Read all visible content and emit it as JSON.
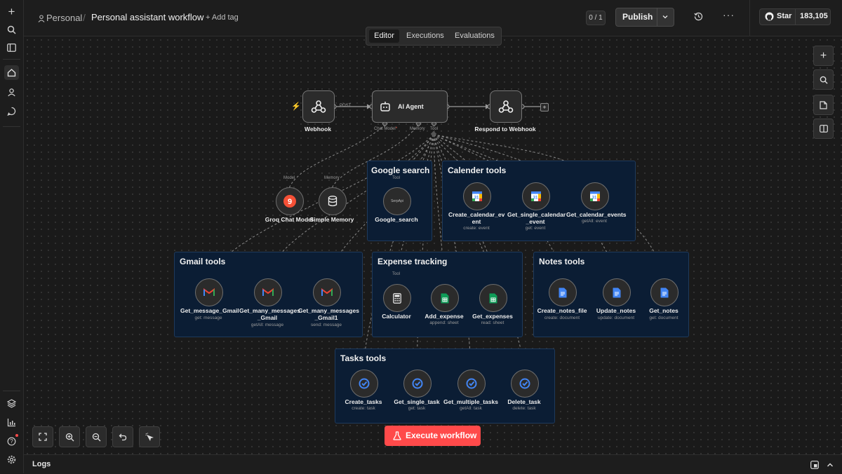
{
  "breadcrumb": {
    "project": "Personal",
    "separator": "/",
    "workflow": "Personal assistant workflow",
    "add_tag": "+ Add tag"
  },
  "header": {
    "version_counter": "0 / 1",
    "publish_label": "Publish",
    "github_star_label": "Star",
    "github_star_count": "183,105"
  },
  "tabs": [
    {
      "label": "Editor",
      "active": true
    },
    {
      "label": "Executions",
      "active": false
    },
    {
      "label": "Evaluations",
      "active": false
    }
  ],
  "main_nodes": {
    "webhook": {
      "label": "Webhook",
      "port_label": "POST"
    },
    "agent": {
      "label": "AI Agent",
      "handle_chat_model": "Chat Model",
      "required_mark": "*",
      "handle_memory": "Memory",
      "handle_tool": "Tool"
    },
    "respond": {
      "label": "Respond to Webhook",
      "plus": "+"
    }
  },
  "sub_nodes": {
    "groq": {
      "label": "Groq Chat Model",
      "handle": "Model",
      "icon_glyph": "9"
    },
    "memory": {
      "label": "Simple Memory",
      "handle": "Memory"
    }
  },
  "groups": {
    "google_search": {
      "title": "Google search",
      "nodes": [
        {
          "label": "Google_search",
          "handle": "Tool",
          "icon_text": "SerpApi"
        }
      ]
    },
    "calendar": {
      "title": "Calender tools",
      "nodes": [
        {
          "label_lines": [
            "Create_calendar_ev",
            "ent"
          ],
          "sub": "create: event"
        },
        {
          "label_lines": [
            "Get_single_calendar",
            "_event"
          ],
          "sub": "get: event"
        },
        {
          "label_lines": [
            "Get_calendar_events"
          ],
          "sub": "getAll: event"
        }
      ]
    },
    "gmail": {
      "title": "Gmail tools",
      "nodes": [
        {
          "label_lines": [
            "Get_message_Gmail"
          ],
          "sub": "get: message"
        },
        {
          "label_lines": [
            "Get_many_messages",
            "_Gmail"
          ],
          "sub": "getAll: message"
        },
        {
          "label_lines": [
            "Get_many_messages",
            "_Gmail1"
          ],
          "sub": "send: message"
        }
      ]
    },
    "expense": {
      "title": "Expense tracking",
      "nodes": [
        {
          "label_lines": [
            "Calculator"
          ],
          "sub": "",
          "handle": "Tool"
        },
        {
          "label_lines": [
            "Add_expense"
          ],
          "sub": "append: sheet"
        },
        {
          "label_lines": [
            "Get_expenses"
          ],
          "sub": "read: sheet"
        }
      ]
    },
    "notes": {
      "title": "Notes tools",
      "nodes": [
        {
          "label_lines": [
            "Create_notes_file"
          ],
          "sub": "create: document"
        },
        {
          "label_lines": [
            "Update_notes"
          ],
          "sub": "update: document"
        },
        {
          "label_lines": [
            "Get_notes"
          ],
          "sub": "get: document"
        }
      ]
    },
    "tasks": {
      "title": "Tasks tools",
      "nodes": [
        {
          "label_lines": [
            "Create_tasks"
          ],
          "sub": "create: task"
        },
        {
          "label_lines": [
            "Get_single_task"
          ],
          "sub": "get: task"
        },
        {
          "label_lines": [
            "Get_multiple_tasks"
          ],
          "sub": "getAll: task"
        },
        {
          "label_lines": [
            "Delete_task"
          ],
          "sub": "delete: task"
        }
      ]
    }
  },
  "execute_button": {
    "label": "Execute workflow"
  },
  "logs": {
    "label": "Logs"
  },
  "colors": {
    "accent": "#ff4a4a",
    "group_bg": "#0b1d34",
    "group_border": "#1e3a5c",
    "canvas_bg": "#1a1a1a"
  }
}
